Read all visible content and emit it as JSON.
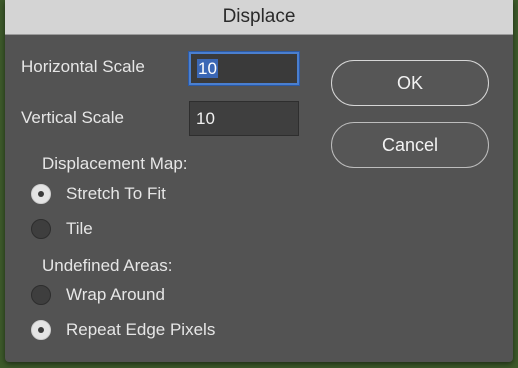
{
  "dialog": {
    "title": "Displace",
    "horizontal_scale": {
      "label": "Horizontal Scale",
      "value": "10"
    },
    "vertical_scale": {
      "label": "Vertical Scale",
      "value": "10"
    },
    "ok_label": "OK",
    "cancel_label": "Cancel",
    "displacement_map": {
      "heading": "Displacement Map:",
      "options": [
        {
          "label": "Stretch To Fit",
          "checked": true
        },
        {
          "label": "Tile",
          "checked": false
        }
      ]
    },
    "undefined_areas": {
      "heading": "Undefined Areas:",
      "options": [
        {
          "label": "Wrap Around",
          "checked": false
        },
        {
          "label": "Repeat Edge Pixels",
          "checked": true
        }
      ]
    }
  },
  "colors": {
    "dialog_bg": "#535353",
    "titlebar_bg": "#d4d4d4",
    "focus_ring": "#4a7fd0",
    "selection": "#3b67b5"
  }
}
